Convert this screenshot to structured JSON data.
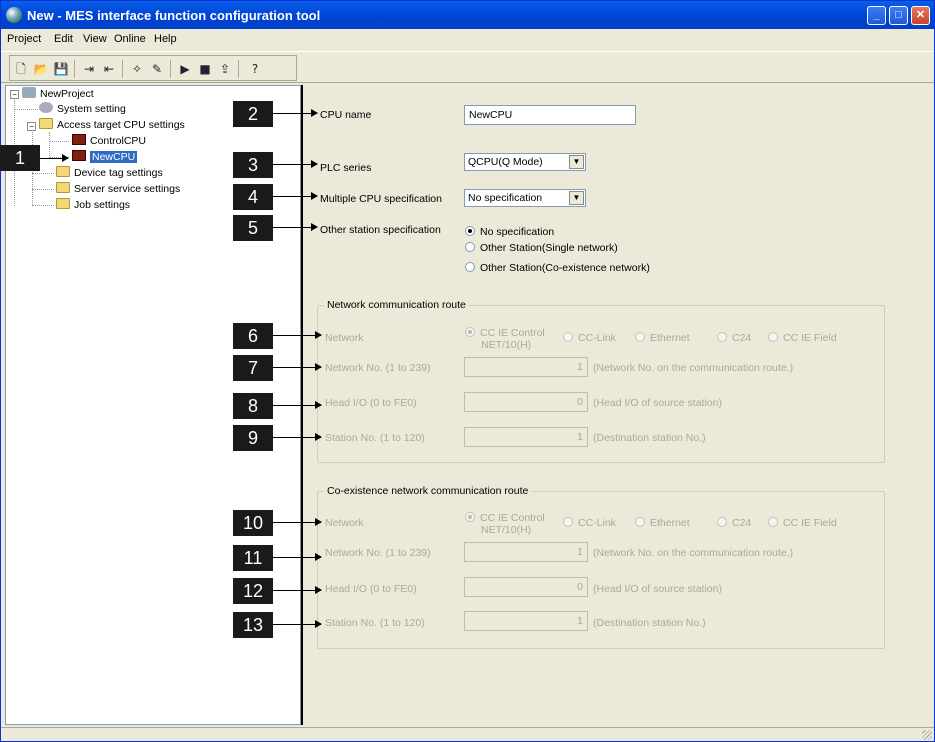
{
  "window": {
    "title": "New - MES interface function configuration tool"
  },
  "menu": [
    "Project",
    "Edit",
    "View",
    "Online",
    "Help"
  ],
  "toolbar": {
    "icons": [
      "new-icon",
      "open-icon",
      "save-icon",
      "import-icon",
      "export-icon",
      "wizard-icon",
      "edit-icon",
      "run-icon",
      "stop-icon",
      "write-icon",
      "help-icon"
    ]
  },
  "tree": {
    "root": "NewProject",
    "system": "System setting",
    "access": "Access target CPU settings",
    "cpu1": "ControlCPU",
    "cpu2": "NewCPU",
    "device": "Device tag settings",
    "server": "Server service settings",
    "job": "Job settings"
  },
  "form": {
    "cpu_name_label": "CPU name",
    "cpu_name_value": "NewCPU",
    "plc_series_label": "PLC series",
    "plc_series_value": "QCPU(Q Mode)",
    "multi_cpu_label": "Multiple CPU specification",
    "multi_cpu_value": "No specification",
    "other_station_label": "Other station specification",
    "other_options": [
      "No specification",
      "Other Station(Single network)",
      "Other Station(Co-existence network)"
    ]
  },
  "net": {
    "group": "Network communication route",
    "network_label": "Network",
    "opt1_l1": "CC IE Control",
    "opt1_l2": "NET/10(H)",
    "opt2": "CC-Link",
    "opt3": "Ethernet",
    "opt4": "C24",
    "opt5": "CC IE Field",
    "netno_label": "Network No. (1 to 239)",
    "netno_value": "1",
    "netno_hint": "(Network No. on the communication route.)",
    "head_label": "Head I/O (0 to FE0)",
    "head_value": "0",
    "head_hint": "(Head I/O of source station)",
    "station_label": "Station No. (1 to 120)",
    "station_value": "1",
    "station_hint": "(Destination station No.)"
  },
  "conet": {
    "group": "Co-existence network communication route",
    "network_label": "Network",
    "opt1_l1": "CC IE Control",
    "opt1_l2": "NET/10(H)",
    "opt2": "CC-Link",
    "opt3": "Ethernet",
    "opt4": "C24",
    "opt5": "CC IE Field",
    "netno_label": "Network No. (1 to 239)",
    "netno_value": "1",
    "netno_hint": "(Network No. on the communication route.)",
    "head_label": "Head I/O (0 to FE0)",
    "head_value": "0",
    "head_hint": "(Head I/O of source station)",
    "station_label": "Station No. (1 to 120)",
    "station_value": "1",
    "station_hint": "(Destination station No.)"
  },
  "callouts": [
    "1",
    "2",
    "3",
    "4",
    "5",
    "6",
    "7",
    "8",
    "9",
    "10",
    "11",
    "12",
    "13"
  ]
}
